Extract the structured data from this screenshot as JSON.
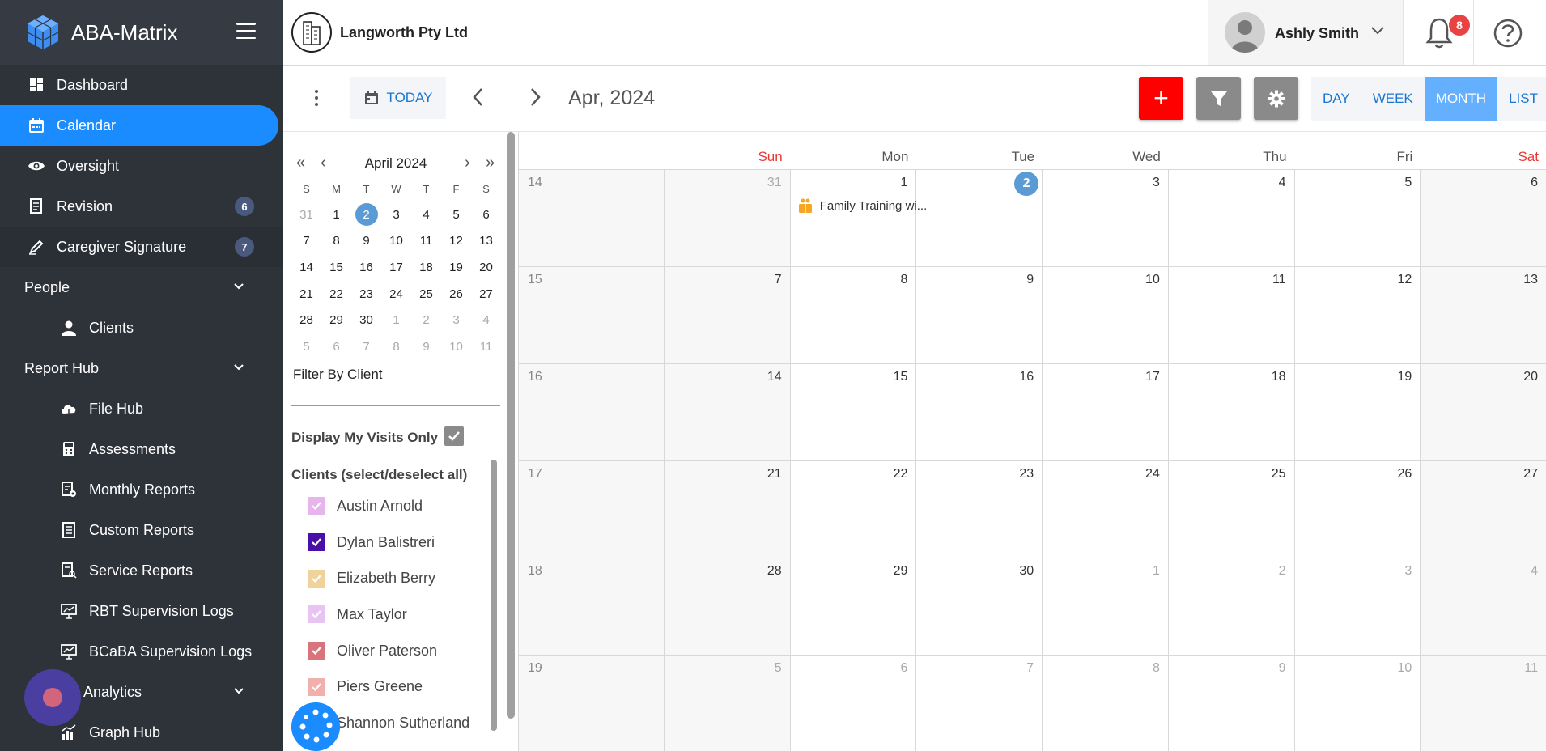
{
  "sidebar": {
    "brand": "ABA-Matrix",
    "items": [
      {
        "label": "Dashboard"
      },
      {
        "label": "Calendar"
      },
      {
        "label": "Oversight"
      },
      {
        "label": "Revision",
        "badge": "6"
      },
      {
        "label": "Caregiver Signature",
        "badge": "7"
      }
    ],
    "people": {
      "label": "People",
      "items": [
        {
          "label": "Clients"
        }
      ]
    },
    "report_hub": {
      "label": "Report Hub",
      "items": [
        {
          "label": "File Hub"
        },
        {
          "label": "Assessments"
        },
        {
          "label": "Monthly Reports"
        },
        {
          "label": "Custom Reports"
        },
        {
          "label": "Service Reports"
        },
        {
          "label": "RBT Supervision Logs"
        },
        {
          "label": "BCaBA Supervision Logs"
        }
      ]
    },
    "analytics": {
      "label": "Analytics",
      "items": [
        {
          "label": "Graph Hub"
        }
      ]
    }
  },
  "header": {
    "company": "Langworth Pty Ltd",
    "user": "Ashly Smith",
    "notifications": "8"
  },
  "toolbar": {
    "today": "TODAY",
    "title": "Apr, 2024",
    "add": "+",
    "views": [
      "DAY",
      "WEEK",
      "MONTH",
      "LIST"
    ],
    "active_view": "MONTH"
  },
  "mini_calendar": {
    "title": "April 2024",
    "dow": [
      "S",
      "M",
      "T",
      "W",
      "T",
      "F",
      "S"
    ],
    "weeks": [
      [
        "31",
        "1",
        "2",
        "3",
        "4",
        "5",
        "6"
      ],
      [
        "7",
        "8",
        "9",
        "10",
        "11",
        "12",
        "13"
      ],
      [
        "14",
        "15",
        "16",
        "17",
        "18",
        "19",
        "20"
      ],
      [
        "21",
        "22",
        "23",
        "24",
        "25",
        "26",
        "27"
      ],
      [
        "28",
        "29",
        "30",
        "1",
        "2",
        "3",
        "4"
      ],
      [
        "5",
        "6",
        "7",
        "8",
        "9",
        "10",
        "11"
      ]
    ],
    "selected": "2"
  },
  "filters": {
    "filter_by_client": "Filter By Client",
    "display_my_visits": "Display My Visits Only",
    "clients_header": "Clients (select/deselect all)",
    "clients": [
      {
        "name": "Austin Arnold",
        "color": "#e8b4ee",
        "checked": true
      },
      {
        "name": "Dylan Balistreri",
        "color": "#4a0fa8",
        "checked": true
      },
      {
        "name": "Elizabeth Berry",
        "color": "#f0d29a",
        "checked": true
      },
      {
        "name": "Max Taylor",
        "color": "#e8c4f2",
        "checked": true
      },
      {
        "name": "Oliver Paterson",
        "color": "#d9747c",
        "checked": true
      },
      {
        "name": "Piers Greene",
        "color": "#f2b0ac",
        "checked": true
      },
      {
        "name": "Shannon Sutherland",
        "color": "#3a7bd5",
        "checked": true
      }
    ]
  },
  "calendar": {
    "dow": [
      "Sun",
      "Mon",
      "Tue",
      "Wed",
      "Thu",
      "Fri",
      "Sat"
    ],
    "weeks": [
      {
        "wk": "14",
        "days": [
          "31",
          "1",
          "2",
          "3",
          "4",
          "5",
          "6"
        ]
      },
      {
        "wk": "15",
        "days": [
          "7",
          "8",
          "9",
          "10",
          "11",
          "12",
          "13"
        ]
      },
      {
        "wk": "16",
        "days": [
          "14",
          "15",
          "16",
          "17",
          "18",
          "19",
          "20"
        ]
      },
      {
        "wk": "17",
        "days": [
          "21",
          "22",
          "23",
          "24",
          "25",
          "26",
          "27"
        ]
      },
      {
        "wk": "18",
        "days": [
          "28",
          "29",
          "30",
          "1",
          "2",
          "3",
          "4"
        ]
      },
      {
        "wk": "19",
        "days": [
          "5",
          "6",
          "7",
          "8",
          "9",
          "10",
          "11"
        ]
      }
    ],
    "today": "2",
    "event": {
      "title": "Family Training wi...",
      "day": "1",
      "color": "#f5a623"
    }
  },
  "colors": {
    "sidebar_bg": "#2e3239",
    "accent": "#1a8cff",
    "add_button": "#ff0000",
    "badge": "#e84242"
  }
}
